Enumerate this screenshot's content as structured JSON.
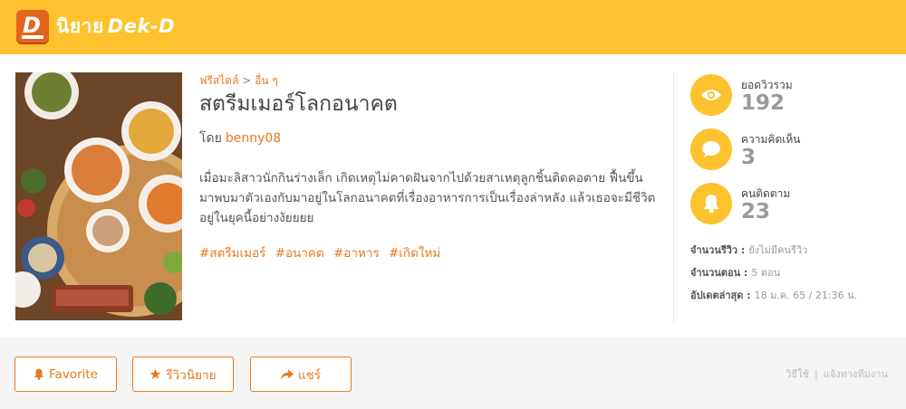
{
  "header": {
    "logo_letter": "D",
    "logo_thai": "นิยาย",
    "logo_brand": "Dek-D"
  },
  "novel": {
    "breadcrumb": {
      "category": "ฟรีสไตล์",
      "separator": ">",
      "subcategory": "อื่น ๆ"
    },
    "title": "สตรีมเมอร์โลกอนาคต",
    "author_prefix": "โดย",
    "author": "benny08",
    "synopsis": "เมื่อมะลิสาวนักกินร่างเล็ก เกิดเหตุไม่คาดฝันจากไปด้วยสาเหตุลูกชิ้นติดคอตาย ฟื้นขึ้นมาพบมาตัวเองกับมาอยู่ในโลกอนาคตที่เรื่องอาหารการเป็นเรื่องล่าหลัง แล้วเธอจะมีชีวิตอยู่ในยุคนี้อย่างงัยยยย",
    "tags": [
      "#สตรีมเมอร์",
      "#อนาคต",
      "#อาหาร",
      "#เกิดใหม่"
    ]
  },
  "stats": {
    "views_label": "ยอดวิวรวม",
    "views": "192",
    "comments_label": "ความคิดเห็น",
    "comments": "3",
    "followers_label": "คนติดตาม",
    "followers": "23",
    "reviews_label": "จำนวนรีวิว :",
    "reviews_value": "ยังไม่มีคนรีวิว",
    "episodes_label": "จำนวนตอน :",
    "episodes_value": "5 ตอน",
    "updated_label": "อัปเดตล่าสุด :",
    "updated_value": "18 ม.ค. 65 / 21:36 น."
  },
  "actions": {
    "favorite": "Favorite",
    "review": "รีวิวนิยาย",
    "share": "แชร์"
  },
  "footer_links": {
    "howto": "วิธีใช้",
    "separator": "|",
    "report": "แจ้งทางทีมงาน"
  },
  "colors": {
    "header_bg": "#fec22e",
    "accent": "#e87a1c",
    "icon_circle": "#fec22e",
    "stat_value": "#9a9a9a"
  }
}
